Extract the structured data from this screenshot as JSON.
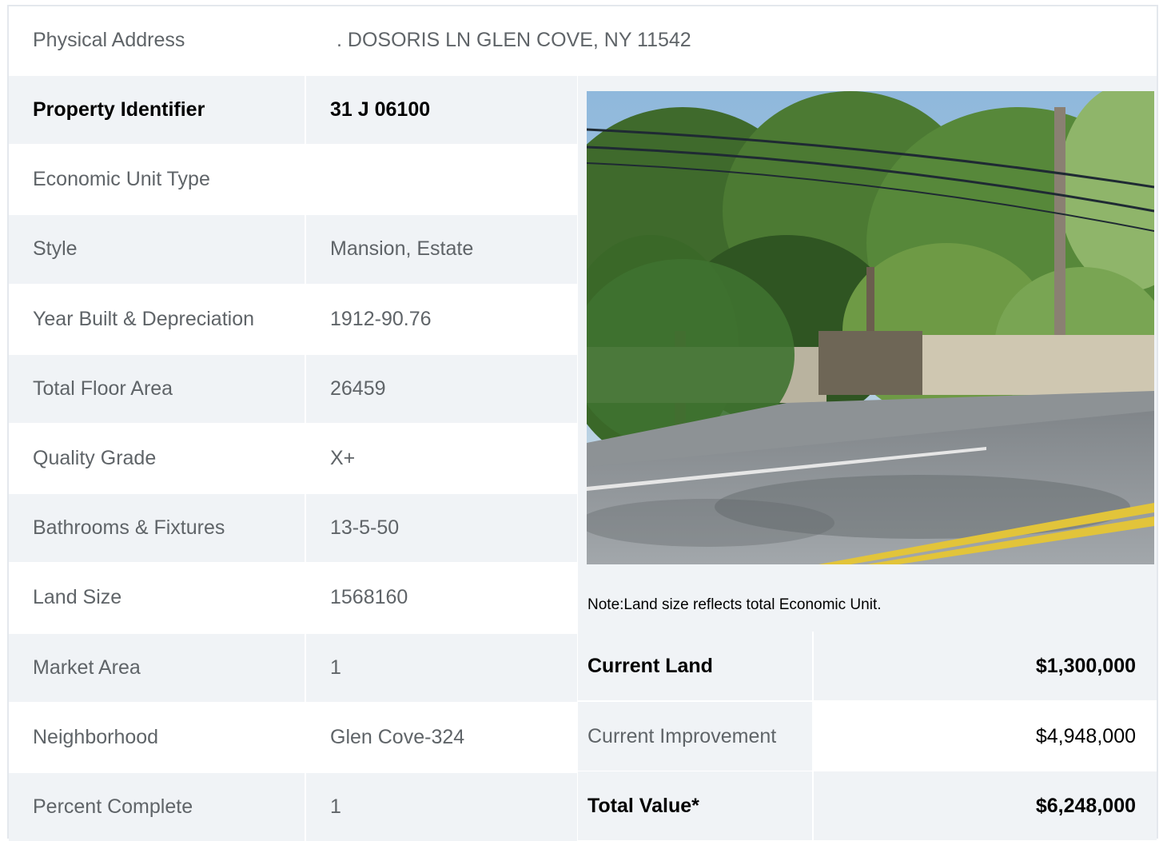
{
  "address": {
    "label": "Physical Address",
    "value": ".  DOSORIS LN  GLEN COVE, NY  11542"
  },
  "rows": [
    {
      "label": "Property Identifier",
      "value": "31  J  06100",
      "bold": true
    },
    {
      "label": "Economic Unit Type",
      "value": ""
    },
    {
      "label": "Style",
      "value": "Mansion, Estate"
    },
    {
      "label": "Year Built & Depreciation",
      "value": "1912-90.76"
    },
    {
      "label": "Total Floor Area",
      "value": "26459"
    },
    {
      "label": "Quality Grade",
      "value": "X+"
    },
    {
      "label": "Bathrooms & Fixtures",
      "value": "13-5-50"
    },
    {
      "label": "Land Size",
      "value": "1568160"
    },
    {
      "label": "Market Area",
      "value": "1"
    },
    {
      "label": "Neighborhood",
      "value": "Glen Cove-324"
    },
    {
      "label": "Percent Complete",
      "value": "1"
    }
  ],
  "note": "Note:Land size reflects total Economic Unit.",
  "values": [
    {
      "label": "Current Land",
      "value": "$1,300,000",
      "bold": true
    },
    {
      "label": "Current Improvement",
      "value": "$4,948,000",
      "bold": false
    },
    {
      "label": "Total Value*",
      "value": "$6,248,000",
      "bold": true
    }
  ],
  "colors": {
    "stripe": "#f0f3f6",
    "white": "#ffffff",
    "border": "#e4e8ed",
    "label_text": "#5f6468"
  }
}
